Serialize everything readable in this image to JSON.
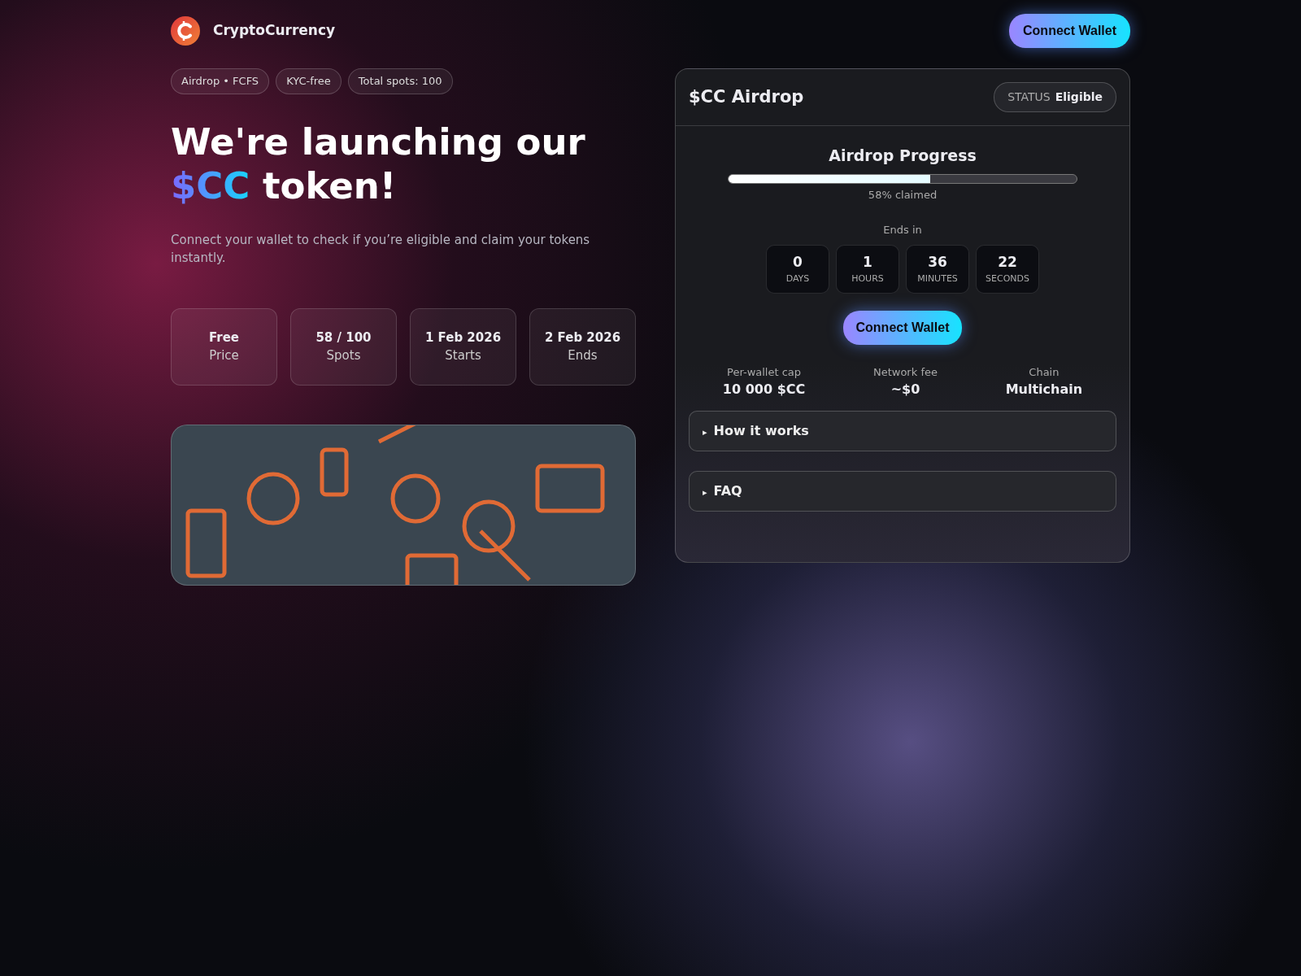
{
  "brand": {
    "name": "CryptoCurrency"
  },
  "header_button": "Connect Wallet",
  "tags": [
    "Airdrop • FCFS",
    "KYC-free",
    "Total spots: 100"
  ],
  "headline": {
    "before": "We're launching our ",
    "highlight": "$CC",
    "after": " token!"
  },
  "subtitle": "Connect your wallet to check if you’re eligible and claim your tokens instantly.",
  "stats": [
    {
      "value": "Free",
      "label": "Price"
    },
    {
      "value": "58 / 100",
      "label": "Spots"
    },
    {
      "value": "1 Feb 2026",
      "label": "Starts"
    },
    {
      "value": "2 Feb 2026",
      "label": "Ends"
    }
  ],
  "panel": {
    "title": "$CC Airdrop",
    "status_label": "STATUS",
    "status_value": "Eligible",
    "progress_title": "Airdrop Progress",
    "progress": {
      "level": 0.58,
      "caption": "58% claimed"
    },
    "countdown_label": "Ends in",
    "countdown": [
      {
        "value": "0",
        "unit": "DAYS"
      },
      {
        "value": "1",
        "unit": "HOURS"
      },
      {
        "value": "36",
        "unit": "MINUTES"
      },
      {
        "value": "22",
        "unit": "SECONDS"
      }
    ],
    "button": "Connect Wallet",
    "facts": [
      {
        "label": "Per-wallet cap",
        "value": "10 000 $CC"
      },
      {
        "label": "Network fee",
        "value": "~$0"
      },
      {
        "label": "Chain",
        "value": "Multichain"
      }
    ],
    "sections": [
      {
        "marker": "▸",
        "title": "How it works",
        "expanded": false
      },
      {
        "marker": "▸",
        "title": "FAQ",
        "expanded": false
      }
    ]
  }
}
